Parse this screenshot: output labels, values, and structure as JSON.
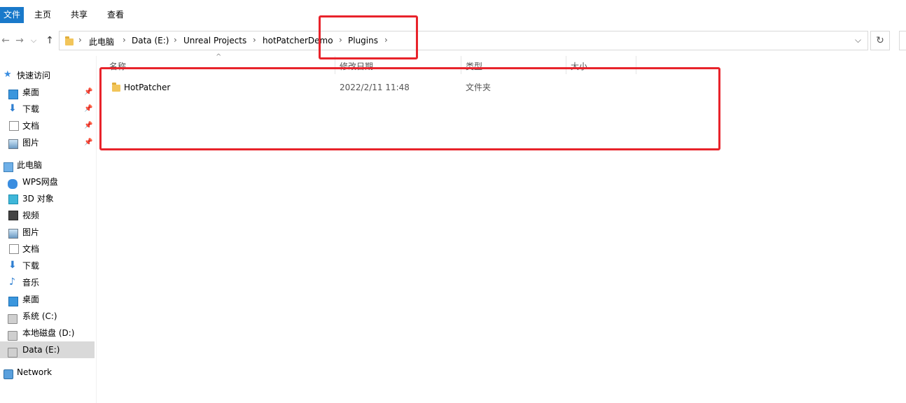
{
  "ribbon": {
    "file_tab": "文件",
    "tabs": [
      "主页",
      "共享",
      "查看"
    ]
  },
  "nav": {
    "back": "←",
    "forward": "→",
    "up": "↑",
    "dropdown": "⌵",
    "refresh": "↻"
  },
  "breadcrumb": [
    "此电脑",
    "Data (E:)",
    "Unreal Projects",
    "hotPatcherDemo",
    "Plugins"
  ],
  "breadcrumb_sep": "›",
  "sidebar": {
    "quick_access": "快速访问",
    "quick_items": [
      "桌面",
      "下载",
      "文档",
      "图片"
    ],
    "this_pc": "此电脑",
    "pc_items": [
      "WPS网盘",
      "3D 对象",
      "视频",
      "图片",
      "文档",
      "下载",
      "音乐",
      "桌面",
      "系统 (C:)",
      "本地磁盘 (D:)",
      "Data (E:)"
    ],
    "network": "Network"
  },
  "columns": {
    "sort_indicator": "^",
    "name": "名称",
    "date": "修改日期",
    "type": "类型",
    "size": "大小"
  },
  "files": [
    {
      "name": "HotPatcher",
      "date": "2022/2/11 11:48",
      "type": "文件夹",
      "size": ""
    }
  ],
  "colors": {
    "accent": "#1979ca",
    "annotation": "#e8232b",
    "folder": "#f2c55a"
  }
}
